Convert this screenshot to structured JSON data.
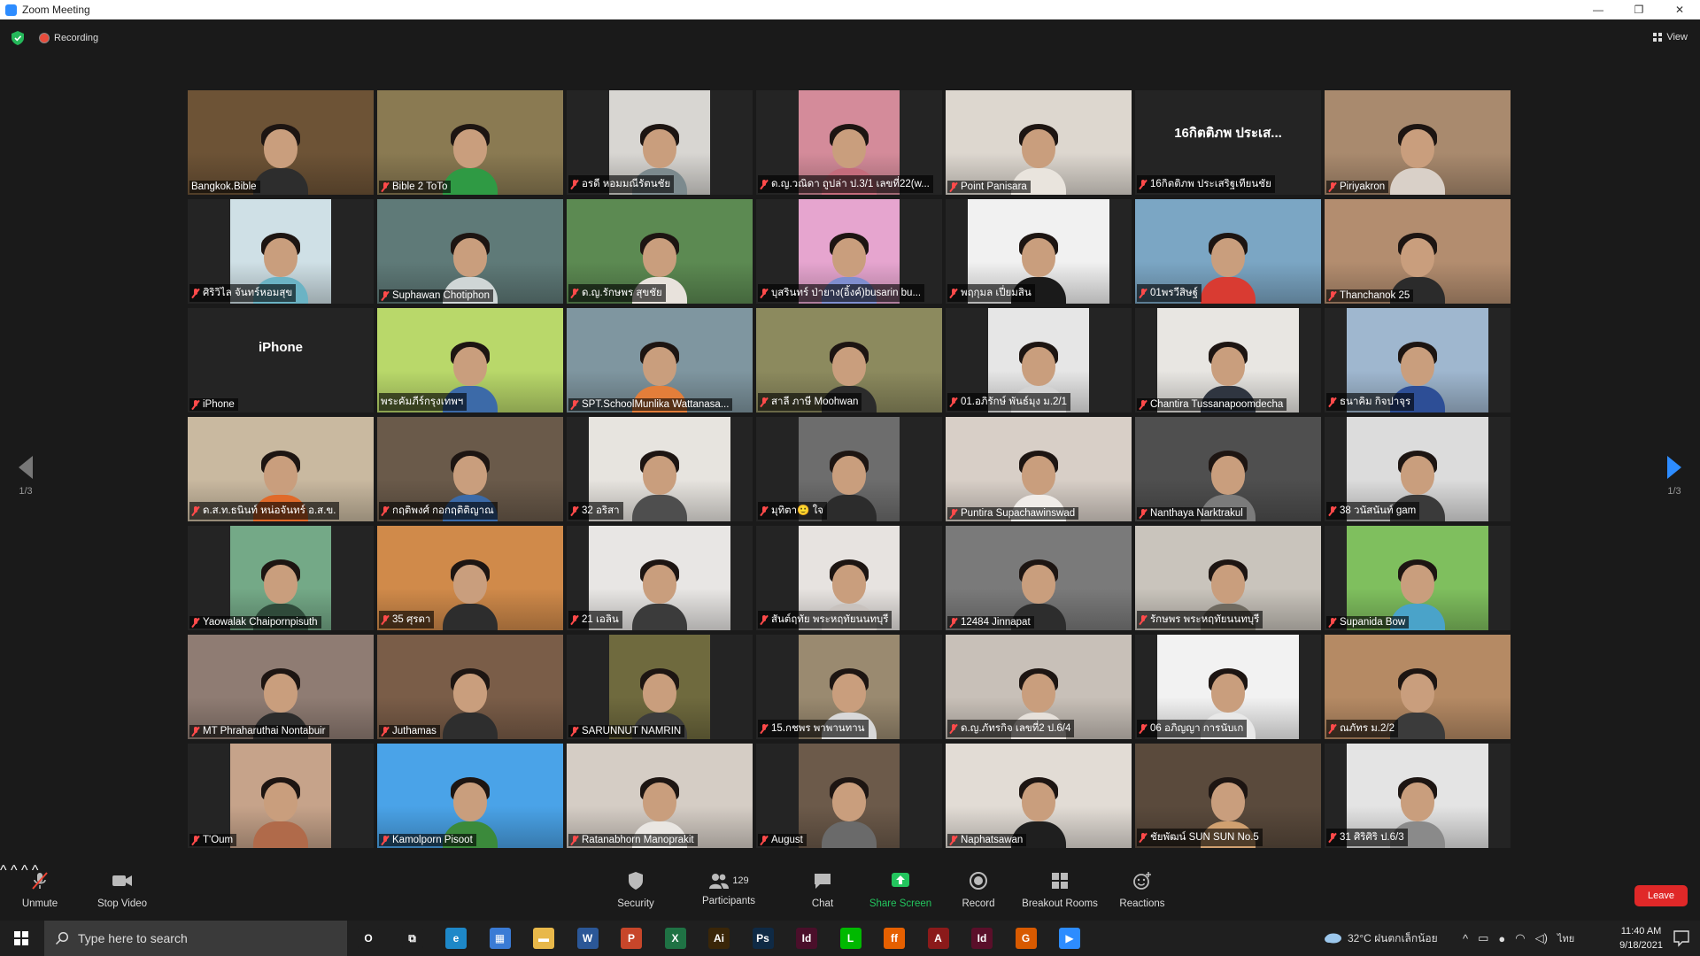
{
  "window": {
    "title": "Zoom Meeting",
    "minimize": "—",
    "maximize": "❐",
    "close": "✕"
  },
  "status": {
    "recording": "Recording",
    "view": "View"
  },
  "pager": {
    "left": "1/3",
    "right": "1/3"
  },
  "participants": [
    {
      "name": "Bangkok.Bible",
      "muted": false,
      "active": true,
      "bg": "#6d5336",
      "shirt": "#2d2d2d",
      "layout": "full"
    },
    {
      "name": "Bible 2 ToTo",
      "muted": true,
      "bg": "#8a7a52",
      "shirt": "#2f9a44",
      "layout": "full"
    },
    {
      "name": "อรดี หอมมณีรัตนชัย",
      "muted": true,
      "bg": "#d8d6d2",
      "shirt": "#7c8a8e",
      "layout": "narrow"
    },
    {
      "name": "ด.ญ.วณิดา ถูปล่า ป.3/1 เลขที่22(w...",
      "muted": true,
      "bg": "#d48b9a",
      "shirt": "#c46c7c",
      "layout": "narrow"
    },
    {
      "name": "Point Panisara",
      "muted": true,
      "bg": "#ddd7cf",
      "shirt": "#e9e4dd",
      "layout": "full"
    },
    {
      "name": "16กิตติภพ ประเสริฐเทียนชัย",
      "muted": true,
      "bg": "#242424",
      "shirt": "#242424",
      "layout": "none",
      "bigname": "16กิตติภพ ประเส..."
    },
    {
      "name": "Piriyakron",
      "muted": true,
      "bg": "#a98a6e",
      "shirt": "#d9d0c8",
      "layout": "full"
    },
    {
      "name": "ศิริวิไล จันทร์หอมสุข",
      "muted": true,
      "bg": "#cfe0e6",
      "shirt": "#6bb3c4",
      "layout": "narrow"
    },
    {
      "name": "Suphawan Chotiphon",
      "muted": true,
      "bg": "#5f7a78",
      "shirt": "#cfd6d6",
      "layout": "full"
    },
    {
      "name": "ด.ญ.รักษพร สุขชัย",
      "muted": true,
      "bg": "#5c8a52",
      "shirt": "#e8e2dc",
      "layout": "full"
    },
    {
      "name": "บุสรินทร์ ป่ายาง(อิ้งค์)busarin bu...",
      "muted": true,
      "bg": "#e6a5cf",
      "shirt": "#7f8ecf",
      "layout": "narrow"
    },
    {
      "name": "พฤกุมล เปี่ยมสิน",
      "muted": true,
      "bg": "#f1f1f1",
      "shirt": "#1a1a1a",
      "layout": "mid"
    },
    {
      "name": "01พรวีสิษฐ์",
      "muted": true,
      "bg": "#7ba6c4",
      "shirt": "#d93b32",
      "layout": "full"
    },
    {
      "name": "Thanchanok 25",
      "muted": true,
      "bg": "#b38d6f",
      "shirt": "#2b2b2b",
      "layout": "full"
    },
    {
      "name": "iPhone",
      "muted": true,
      "bg": "#242424",
      "shirt": "#242424",
      "layout": "none",
      "bigname": "iPhone"
    },
    {
      "name": "พระคัมภีร์กรุงเทพฯ",
      "muted": false,
      "bg": "#b9d86a",
      "shirt": "#3c6aa8",
      "layout": "full"
    },
    {
      "name": "SPT.SchoolMunlika Wattanasa...",
      "muted": true,
      "bg": "#7f96a0",
      "shirt": "#e37e3a",
      "layout": "full"
    },
    {
      "name": "สาลี ภาษี Moohwan",
      "muted": true,
      "bg": "#8c8a5e",
      "shirt": "#2b2b2b",
      "layout": "full"
    },
    {
      "name": "01.อภิรักษ์ พันธ์มุง ม.2/1",
      "muted": true,
      "bg": "#e6e6e6",
      "shirt": "#d3d3d3",
      "layout": "narrow"
    },
    {
      "name": "Chantira Tussanapoomdecha",
      "muted": true,
      "bg": "#e8e6e2",
      "shirt": "#2f3540",
      "layout": "mid"
    },
    {
      "name": "ธนาคิม กิจปาจุร",
      "muted": true,
      "bg": "#9fb7cf",
      "shirt": "#2d4e96",
      "layout": "mid"
    },
    {
      "name": "ด.ส.ท.ธนินท์ หน่อจันทร์ อ.ส.ข.",
      "muted": true,
      "bg": "#c9b9a0",
      "shirt": "#e06a2a",
      "layout": "full"
    },
    {
      "name": "กฤติพงศ์ กอกฤติติญาณ",
      "muted": true,
      "bg": "#6a5a4a",
      "shirt": "#3b6aa8",
      "layout": "full"
    },
    {
      "name": "32 อริสา",
      "muted": true,
      "bg": "#e7e4df",
      "shirt": "#4e4e4e",
      "layout": "mid"
    },
    {
      "name": "มุทิตา🙂 ใจ",
      "muted": true,
      "bg": "#6d6d6d",
      "shirt": "#2c2c2c",
      "layout": "narrow"
    },
    {
      "name": "Puntira Supachawinswad",
      "muted": true,
      "bg": "#d8cfc7",
      "shirt": "#f0ece8",
      "layout": "full"
    },
    {
      "name": "Nanthaya Narktrakul",
      "muted": true,
      "bg": "#4f4f4f",
      "shirt": "#7b7b7b",
      "layout": "full"
    },
    {
      "name": "38 วนัสนันท์ gam",
      "muted": true,
      "bg": "#dcdcdc",
      "shirt": "#3a3a3a",
      "layout": "mid"
    },
    {
      "name": "Yaowalak Chaipornpisuth",
      "muted": true,
      "bg": "#74a987",
      "shirt": "#2f4a3a",
      "layout": "narrow"
    },
    {
      "name": "35 ศุรดา",
      "muted": true,
      "bg": "#d08a4a",
      "shirt": "#2d2d2d",
      "layout": "full"
    },
    {
      "name": "21 เอลิน",
      "muted": true,
      "bg": "#e8e6e4",
      "shirt": "#3b3b3b",
      "layout": "mid"
    },
    {
      "name": "สันต์ฤทัย พระหฤทัยนนทบุรี",
      "muted": true,
      "bg": "#e7e3e0",
      "shirt": "#c8c2be",
      "layout": "narrow"
    },
    {
      "name": "12484 Jinnapat",
      "muted": true,
      "bg": "#7a7a7a",
      "shirt": "#2d2d2d",
      "layout": "full"
    },
    {
      "name": "รักษพร พระหฤทัยนนทบุรี",
      "muted": true,
      "bg": "#c9c4bc",
      "shirt": "#6f6a60",
      "layout": "full"
    },
    {
      "name": "Supanida Bow",
      "muted": true,
      "bg": "#7fbf5e",
      "shirt": "#4aa3c9",
      "layout": "mid"
    },
    {
      "name": "MT Phraharuthai Nontabuir",
      "muted": true,
      "bg": "#8f7c73",
      "shirt": "#2c2c2c",
      "layout": "full"
    },
    {
      "name": "Juthamas",
      "muted": true,
      "bg": "#7a5d48",
      "shirt": "#2e2e2e",
      "layout": "full"
    },
    {
      "name": "SARUNNUT NAMRIN",
      "muted": true,
      "bg": "#6f6a3e",
      "shirt": "#3c3c3c",
      "layout": "narrow"
    },
    {
      "name": "15.กชพร พาพานทาน",
      "muted": true,
      "bg": "#9a8a70",
      "shirt": "#d8d8d8",
      "layout": "narrow"
    },
    {
      "name": "ด.ญ.ภัทรกิจ เลขที่2 ป.6/4",
      "muted": true,
      "bg": "#c8c0b8",
      "shirt": "#e6e0da",
      "layout": "full"
    },
    {
      "name": "06 อภิญญา การนับเก",
      "muted": true,
      "bg": "#f2f2f2",
      "shirt": "#e8e8e8",
      "layout": "mid"
    },
    {
      "name": "ณภัทร ม.2/2",
      "muted": true,
      "bg": "#b58a64",
      "shirt": "#3b3b3b",
      "layout": "full"
    },
    {
      "name": "T'Oum",
      "muted": true,
      "bg": "#c6a38a",
      "shirt": "#b06a4a",
      "layout": "narrow"
    },
    {
      "name": "Kamolporn Pisoot",
      "muted": true,
      "bg": "#4aa3e8",
      "shirt": "#3b8a3b",
      "layout": "full"
    },
    {
      "name": "Ratanabhorn Manoprakit",
      "muted": true,
      "bg": "#d5cdc5",
      "shirt": "#e9e6e2",
      "layout": "full"
    },
    {
      "name": "August",
      "muted": true,
      "bg": "#6c5a4a",
      "shirt": "#6a6a6a",
      "layout": "narrow"
    },
    {
      "name": "Naphatsawan",
      "muted": true,
      "bg": "#e2dcd5",
      "shirt": "#1f1f1f",
      "layout": "full"
    },
    {
      "name": "ชัยพัฒน์ SUN SUN No.5",
      "muted": true,
      "bg": "#5a4a3c",
      "shirt": "#d0a070",
      "layout": "full"
    },
    {
      "name": "31 ศิริศิริ ป.6/3",
      "muted": true,
      "bg": "#e4e4e4",
      "shirt": "#8a8a8a",
      "layout": "mid"
    }
  ],
  "toolbar": {
    "unmute": "Unmute",
    "stop_video": "Stop Video",
    "security": "Security",
    "participants": "Participants",
    "participants_count": "129",
    "chat": "Chat",
    "share_screen": "Share Screen",
    "record": "Record",
    "breakout_rooms": "Breakout Rooms",
    "reactions": "Reactions",
    "leave": "Leave"
  },
  "taskbar": {
    "search_placeholder": "Type here to search",
    "weather": "32°C ฝนตกเล็กน้อย",
    "language": "ไทย",
    "time": "11:40 AM",
    "date": "9/18/2021",
    "apps": [
      {
        "name": "cortana-icon",
        "label": "O",
        "color": "#1f1f1f"
      },
      {
        "name": "task-view-icon",
        "label": "⧉",
        "color": "#1f1f1f"
      },
      {
        "name": "edge-icon",
        "label": "e",
        "color": "#1e88c8"
      },
      {
        "name": "calculator-icon",
        "label": "▦",
        "color": "#3a7bd5"
      },
      {
        "name": "file-explorer-icon",
        "label": "▬",
        "color": "#e8b84a"
      },
      {
        "name": "word-icon",
        "label": "W",
        "color": "#2b5797"
      },
      {
        "name": "powerpoint-icon",
        "label": "P",
        "color": "#c7462a"
      },
      {
        "name": "excel-icon",
        "label": "X",
        "color": "#1f7244"
      },
      {
        "name": "illustrator-icon",
        "label": "Ai",
        "color": "#3a2608"
      },
      {
        "name": "photoshop-icon",
        "label": "Ps",
        "color": "#0f2a45"
      },
      {
        "name": "indesign-icon",
        "label": "Id",
        "color": "#4a0f2a"
      },
      {
        "name": "line-icon",
        "label": "L",
        "color": "#00b900"
      },
      {
        "name": "firefox-icon",
        "label": "ff",
        "color": "#e66000"
      },
      {
        "name": "acrobat-icon",
        "label": "A",
        "color": "#8b1a1a"
      },
      {
        "name": "indesign-icon-2",
        "label": "Id",
        "color": "#5a0f2a"
      },
      {
        "name": "grammarly-icon",
        "label": "G",
        "color": "#d85a00"
      },
      {
        "name": "zoom-icon",
        "label": "▶",
        "color": "#2d8cff"
      }
    ]
  }
}
